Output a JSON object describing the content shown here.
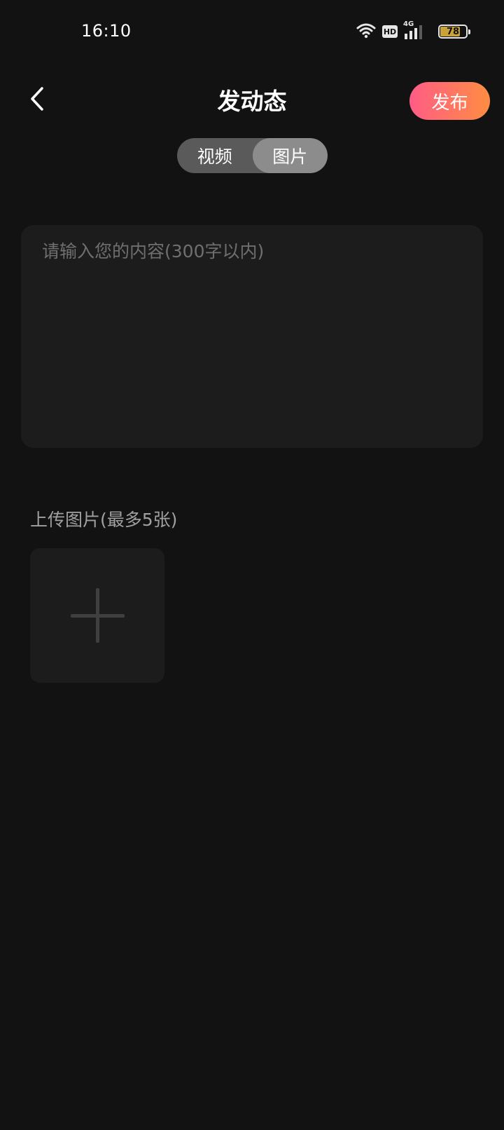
{
  "status_bar": {
    "time": "16:10",
    "network_badge": "HD",
    "network_type": "4G",
    "battery_level": "78",
    "icons": [
      "wifi-icon",
      "hd-icon",
      "signal-icon",
      "battery-icon"
    ]
  },
  "header": {
    "title": "发动态",
    "publish_label": "发布",
    "back_icon": "chevron-left-icon"
  },
  "segment": {
    "tabs": [
      {
        "label": "视频",
        "active": false
      },
      {
        "label": "图片",
        "active": true
      }
    ]
  },
  "content": {
    "placeholder": "请输入您的内容(300字以内)",
    "value": ""
  },
  "upload": {
    "label": "上传图片(最多5张)",
    "add_icon": "plus-icon"
  },
  "colors": {
    "background": "#121212",
    "card": "#1c1c1c",
    "publish_gradient_start": "#ff5c86",
    "publish_gradient_end": "#ff8d42",
    "segment_bg": "#5a5a5a",
    "segment_active": "#8c8c8c"
  }
}
